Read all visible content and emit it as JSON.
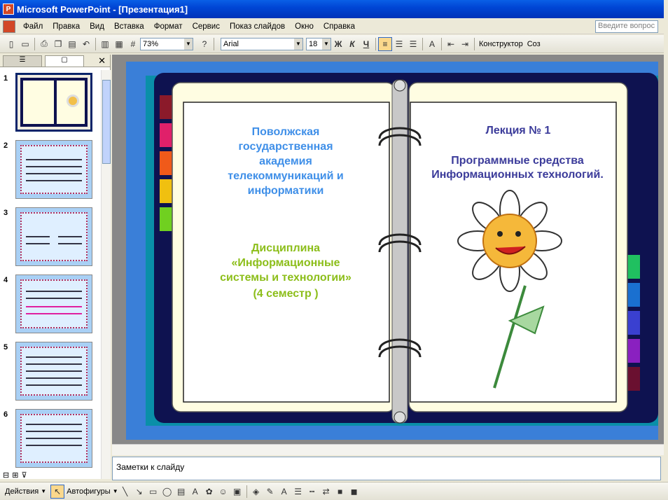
{
  "window": {
    "title": "Microsoft PowerPoint - [Презентация1]"
  },
  "menu": {
    "items": [
      "Файл",
      "Правка",
      "Вид",
      "Вставка",
      "Формат",
      "Сервис",
      "Показ слайдов",
      "Окно",
      "Справка"
    ],
    "help_placeholder": "Введите вопрос"
  },
  "toolbar": {
    "zoom": "73%",
    "font": "Arial",
    "size": "18",
    "bold": "Ж",
    "italic": "К",
    "underline": "Ч",
    "designer": "Конструктор",
    "create": "Соз"
  },
  "pane": {
    "tab_outline": "☰",
    "tab_slides": "▢",
    "close": "✕",
    "slides": [
      {
        "num": "1"
      },
      {
        "num": "2"
      },
      {
        "num": "3"
      },
      {
        "num": "4"
      },
      {
        "num": "5"
      },
      {
        "num": "6"
      }
    ]
  },
  "slide": {
    "left_title": "Поволжская государственная академия телекоммуникаций и информатики",
    "left_subtitle_1": "Дисциплина",
    "left_subtitle_2": "«Информационные системы и технологии»",
    "left_subtitle_3": "(4 семестр )",
    "right_title": "Лекция № 1",
    "right_subtitle": "Программные средства Информационных технологий.",
    "colors": {
      "left_title": "#3f8fe8",
      "left_sub": "#8cbe1a",
      "right": "#3b3b9a",
      "frame": "#0e1250",
      "page": "#fffde2"
    }
  },
  "notes": {
    "placeholder": "Заметки к слайду"
  },
  "drawing": {
    "actions": "Действия",
    "autoshapes": "Автофигуры"
  }
}
